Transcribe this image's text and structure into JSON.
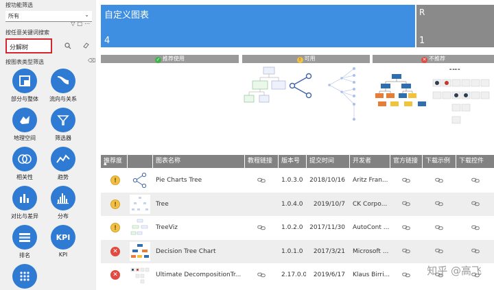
{
  "sidebar": {
    "function_filter_label": "按功能筛选",
    "function_filter_value": "所有",
    "keyword_label": "按任意关键词搜索",
    "keyword_value": "分解树",
    "type_filter_label": "按图表类型筛选",
    "categories": [
      {
        "label": "部分与整体",
        "icon": "part-whole-icon"
      },
      {
        "label": "流向与关系",
        "icon": "flow-relation-icon"
      },
      {
        "label": "地理空间",
        "icon": "geo-icon"
      },
      {
        "label": "筛选器",
        "icon": "funnel-icon"
      },
      {
        "label": "相关性",
        "icon": "correlation-icon"
      },
      {
        "label": "趋势",
        "icon": "trend-icon"
      },
      {
        "label": "对比与差异",
        "icon": "comparison-icon"
      },
      {
        "label": "分布",
        "icon": "distribution-icon"
      },
      {
        "label": "排名",
        "icon": "ranking-icon"
      },
      {
        "label": "KPI",
        "icon_text": "KPI"
      },
      {
        "label": "",
        "icon": "more-dots-icon"
      }
    ]
  },
  "tiles": {
    "main_title": "自定义图表",
    "main_value": "4",
    "grey_title": "R",
    "grey_value": "1"
  },
  "recommendation": {
    "recommended": "推荐使用",
    "usable": "可用",
    "not_recommended": "不推荐"
  },
  "table": {
    "headers": [
      "推荐度",
      "图表名称",
      "教程链接",
      "版本号",
      "提交时间",
      "开发者",
      "官方链接",
      "下载示例",
      "下载控件"
    ],
    "sort_indicator": "▲",
    "rows": [
      {
        "status": "ok",
        "thumb": "share",
        "name": "Pie Charts Tree",
        "tutorial": true,
        "version": "1.0.3.0",
        "date": "2018/10/16",
        "developer": "Aritz Fran..."
      },
      {
        "status": "ok",
        "thumb": "tree-light",
        "name": "Tree",
        "tutorial": false,
        "version": "1.0.4.0",
        "date": "2019/10/7",
        "developer": "CK Corpo..."
      },
      {
        "status": "ok",
        "thumb": "treeviz",
        "name": "TreeViz",
        "tutorial": true,
        "version": "1.0.2.0",
        "date": "2017/11/30",
        "developer": "AutoCont ..."
      },
      {
        "status": "bad",
        "thumb": "decision",
        "name": "Decision Tree Chart",
        "tutorial": false,
        "version": "1.0.1.0",
        "date": "2017/3/21",
        "developer": "Microsoft ..."
      },
      {
        "status": "bad",
        "thumb": "decomp",
        "name": "Ultimate DecompositionTr...",
        "tutorial": true,
        "version": "2.17.0.0",
        "date": "2019/6/17",
        "developer": "Klaus Birri..."
      }
    ]
  },
  "watermark": "知乎 @高飞",
  "colors": {
    "accent": "#3e8ee2",
    "category_blue": "#2f7ad2",
    "header_grey": "#828282",
    "warn": "#f2c047",
    "bad": "#e04a41",
    "search_border": "#d4242c"
  }
}
